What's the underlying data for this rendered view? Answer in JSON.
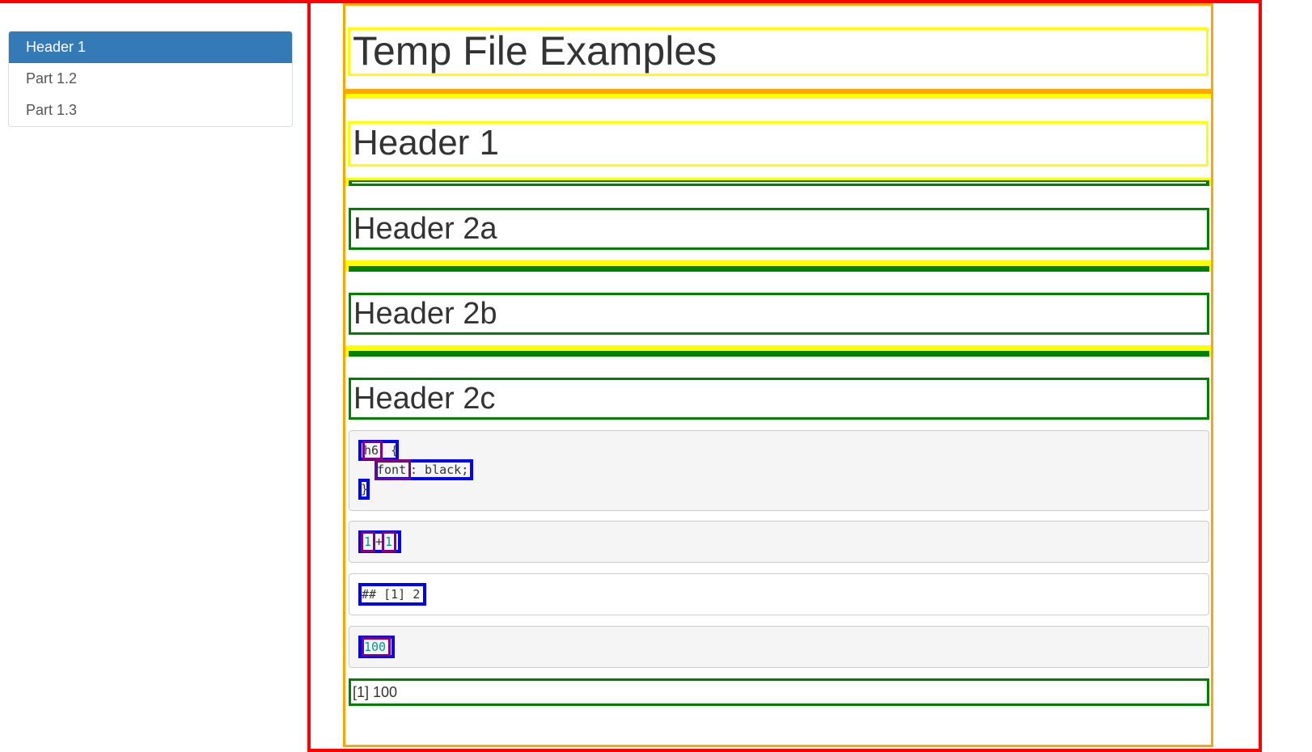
{
  "toc": {
    "items": [
      {
        "label": "Header 1",
        "active": true
      },
      {
        "label": "Part 1.2",
        "active": false
      },
      {
        "label": "Part 1.3",
        "active": false
      }
    ]
  },
  "main": {
    "title": "Temp File Examples",
    "header1": "Header 1",
    "header2a": "Header 2a",
    "header2b": "Header 2b",
    "header2c": "Header 2c",
    "code_css": {
      "selector": "h6",
      "open_brace": " {",
      "property": "font",
      "value": ": black;",
      "close_brace": "}"
    },
    "code_r": {
      "left": "1",
      "op": "+",
      "right": "1"
    },
    "output_1": "## [1] 2",
    "code_num": "100",
    "output_2": "[1] 100"
  },
  "colors": {
    "active_bg": "#337ab7",
    "outline_red": "#ff0000",
    "outline_orange": "#ffa500",
    "outline_yellow": "#ffff00",
    "outline_green": "#008000",
    "outline_blue": "#0000ff",
    "outline_purple": "#800080"
  }
}
